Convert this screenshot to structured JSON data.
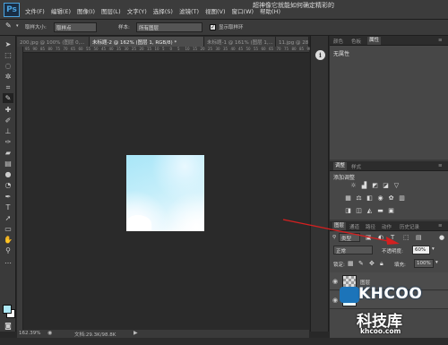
{
  "menubar": {
    "logo": "Ps",
    "items": [
      "文件(F)",
      "编辑(E)",
      "图像(I)",
      "图层(L)",
      "文字(Y)",
      "选择(S)",
      "滤镜(T)",
      "视图(V)",
      "窗口(W)",
      "帮助(H)"
    ],
    "title_overlay": "超神像它就能如何确定精彩的"
  },
  "options": {
    "sample_size_label": "取样大小:",
    "sample_size_value": "取样点",
    "sample_label": "样本:",
    "sample_value": "所有图层",
    "show_ring_label": "显示取样环",
    "show_ring_checked": true
  },
  "tabs": [
    {
      "label": "200.jpg @ 100% (图层 0,...",
      "active": false
    },
    {
      "label": "未标题-2 @ 162% (图层 1, RGB/8) *",
      "active": true
    },
    {
      "label": "未标题-1 @ 161% (图层 1,...",
      "active": false
    },
    {
      "label": "11.jpg @ 28.5% (图层 0,...",
      "active": false
    }
  ],
  "ruler_ticks": [
    "95",
    "90",
    "85",
    "80",
    "75",
    "70",
    "65",
    "60",
    "55",
    "50",
    "45",
    "40",
    "35",
    "30",
    "25",
    "20",
    "15",
    "10",
    "5",
    "0",
    "5",
    "10",
    "15",
    "20",
    "25",
    "30",
    "35",
    "40",
    "45",
    "50",
    "55",
    "60",
    "65",
    "70",
    "75",
    "80",
    "85",
    "90"
  ],
  "status": {
    "zoom": "162.39%",
    "doc_info": "文档:29.3K/98.8K"
  },
  "right": {
    "top_tabs": [
      "颜色",
      "色板",
      "属性"
    ],
    "no_properties": "无属性",
    "adjust_tabs": [
      "调整",
      "样式"
    ],
    "adjust_title": "添加调整",
    "layers_tabs": [
      "图层",
      "通道",
      "路径",
      "动作",
      "历史记录"
    ],
    "kind_label": "类型",
    "blend_mode": "正常",
    "opacity_label": "不透明度:",
    "opacity_value": "60%",
    "lock_label": "锁定:",
    "fill_label": "填充:",
    "fill_value": "100%",
    "layer_name": "图层"
  },
  "watermark": {
    "logo": "KHCOO",
    "cn": "科技库",
    "url": "khcoo.com"
  },
  "colors": {
    "foreground": "#aee9f7",
    "background": "#ffffff",
    "arrow": "#d42020"
  }
}
